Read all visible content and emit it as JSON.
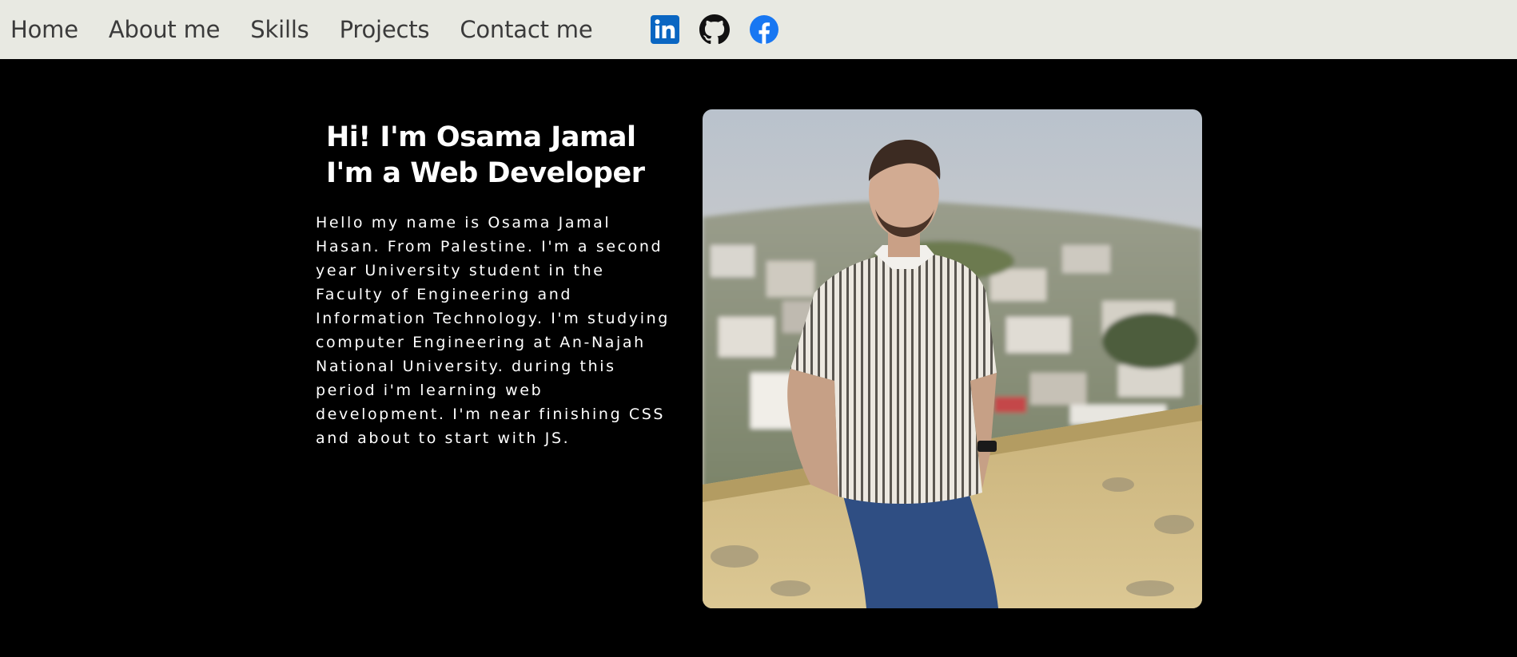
{
  "nav": {
    "links": [
      "Home",
      "About me",
      "Skills",
      "Projects",
      "Contact me"
    ]
  },
  "social": {
    "icons": [
      "linkedin-icon",
      "github-icon",
      "facebook-icon"
    ]
  },
  "hero": {
    "title_line1": "Hi! I'm Osama Jamal",
    "title_line2": "I'm a Web Developer",
    "bio": "Hello my name is Osama Jamal Hasan. From Palestine. I'm a second year University student in the Faculty of Engineering and Information Technology. I'm studying computer Engineering at An-Najah National University. during this period i'm learning web development. I'm near finishing CSS and about to start with JS."
  },
  "colors": {
    "navbar_bg": "#e8e9e2",
    "page_bg": "#000000",
    "linkedin": "#0a66c2",
    "facebook": "#1877f2"
  }
}
